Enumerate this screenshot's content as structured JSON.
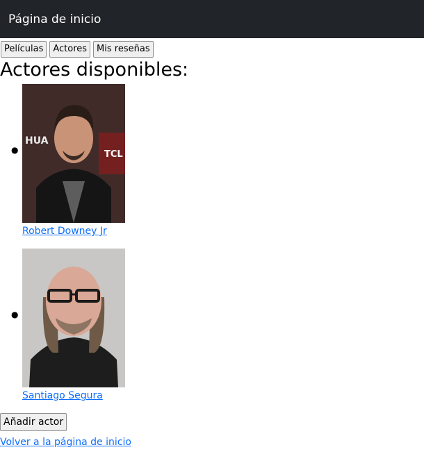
{
  "navbar": {
    "brand": "Página de inicio"
  },
  "menu": {
    "peliculas": "Películas",
    "actores": "Actores",
    "resenas": "Mis reseñas"
  },
  "page": {
    "title": "Actores disponibles:"
  },
  "actors": [
    {
      "name": "Robert Downey Jr"
    },
    {
      "name": "Santiago Segura"
    }
  ],
  "actions": {
    "add_actor": "Añadir actor",
    "back_home": "Volver a la página de inicio"
  }
}
